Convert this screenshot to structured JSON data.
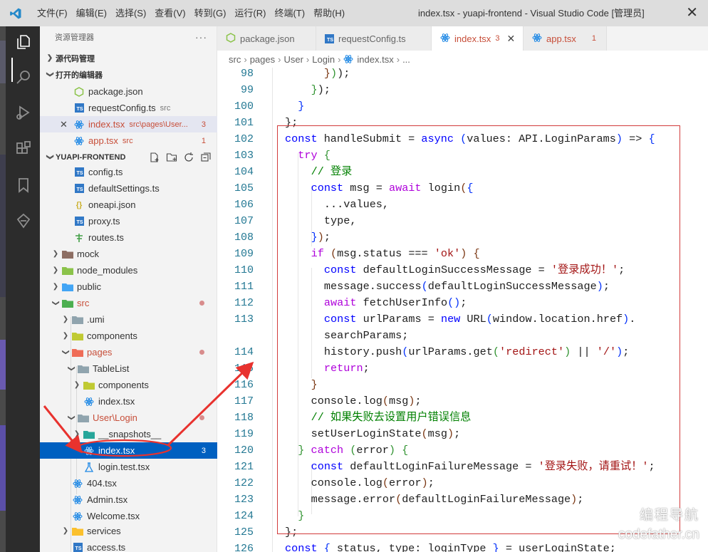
{
  "titlebar": {
    "menu": [
      "文件(F)",
      "编辑(E)",
      "选择(S)",
      "查看(V)",
      "转到(G)",
      "运行(R)",
      "终端(T)",
      "帮助(H)"
    ],
    "window_title": "index.tsx - yuapi-frontend - Visual Studio Code [管理员]",
    "close": "✕"
  },
  "activity_bar": [
    "explorer-icon",
    "search-icon",
    "run-debug-icon",
    "extensions-icon",
    "bookmark-icon",
    "remote-icon"
  ],
  "sidebar": {
    "header": "资源管理器",
    "more": "···",
    "source_control": "源代码管理",
    "open_editors": {
      "title": "打开的编辑器",
      "items": [
        {
          "name": "package.json",
          "path": "",
          "count": ""
        },
        {
          "name": "requestConfig.ts",
          "path": "src",
          "count": ""
        },
        {
          "name": "index.tsx",
          "path": "src\\pages\\User...",
          "count": "3"
        },
        {
          "name": "app.tsx",
          "path": "src",
          "count": "1"
        }
      ]
    },
    "project": {
      "title": "YUAPI-FRONTEND",
      "items": [
        {
          "label": "config.ts"
        },
        {
          "label": "defaultSettings.ts"
        },
        {
          "label": "oneapi.json"
        },
        {
          "label": "proxy.ts"
        },
        {
          "label": "routes.ts"
        },
        {
          "label": "mock"
        },
        {
          "label": "node_modules"
        },
        {
          "label": "public"
        },
        {
          "label": "src"
        },
        {
          "label": ".umi"
        },
        {
          "label": "components"
        },
        {
          "label": "pages"
        },
        {
          "label": "TableList"
        },
        {
          "label": "components"
        },
        {
          "label": "index.tsx"
        },
        {
          "label": "User\\Login"
        },
        {
          "label": "__snapshots__"
        },
        {
          "label": "index.tsx",
          "count": "3"
        },
        {
          "label": "login.test.tsx"
        },
        {
          "label": "404.tsx"
        },
        {
          "label": "Admin.tsx"
        },
        {
          "label": "Welcome.tsx"
        },
        {
          "label": "services"
        },
        {
          "label": "access.ts"
        }
      ]
    }
  },
  "tabs": [
    {
      "label": "package.json",
      "count": ""
    },
    {
      "label": "requestConfig.ts",
      "count": ""
    },
    {
      "label": "index.tsx",
      "count": "3",
      "close": "✕"
    },
    {
      "label": "app.tsx",
      "count": "1"
    }
  ],
  "breadcrumb": [
    "src",
    "pages",
    "User",
    "Login",
    "index.tsx",
    "..."
  ],
  "editor": {
    "line_numbers": [
      "98",
      "99",
      "100",
      "101",
      "102",
      "103",
      "104",
      "105",
      "106",
      "107",
      "108",
      "109",
      "110",
      "111",
      "112",
      "113",
      "",
      "114",
      "115",
      "116",
      "117",
      "118",
      "119",
      "120",
      "121",
      "122",
      "123",
      "124",
      "125",
      "126"
    ]
  },
  "watermark": {
    "line1": "编程导航",
    "line2": "codefather.cn"
  },
  "colors": {
    "accent": "#0060c0",
    "highlight_box": "#d23b3b",
    "annotation_arrow": "#e8322e"
  }
}
